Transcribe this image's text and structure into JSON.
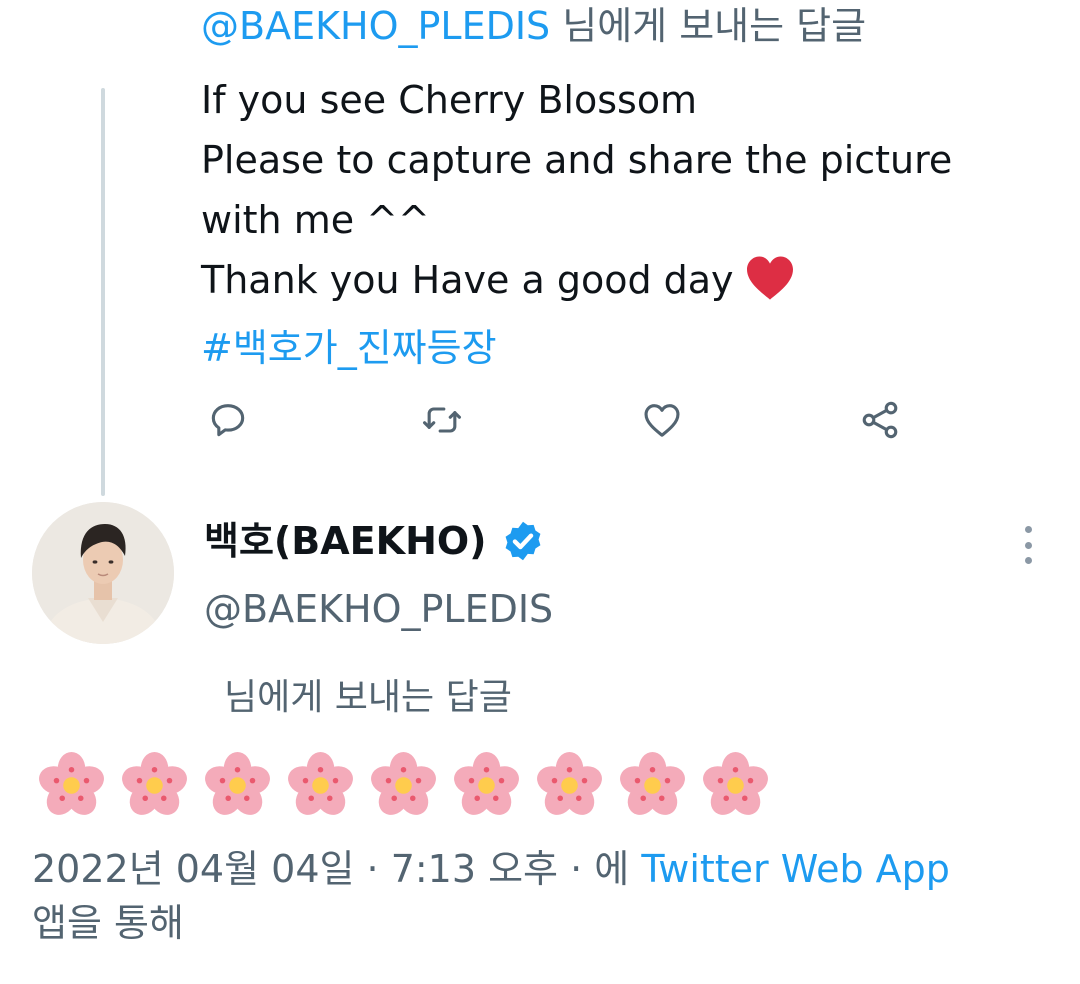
{
  "reply_context": {
    "handle": "@BAEKHO_PLEDIS",
    "suffix": "님에게 보내는 답글"
  },
  "parent_tweet": {
    "lines": [
      "If you see Cherry Blossom",
      "Please to capture and share the picture",
      "with me ^^",
      "Thank you Have a good day"
    ],
    "emoji": "❤",
    "hashtag": "#백호가_진짜등장"
  },
  "actions": [
    {
      "name": "reply",
      "icon": "reply-icon"
    },
    {
      "name": "retweet",
      "icon": "retweet-icon"
    },
    {
      "name": "like",
      "icon": "heart-icon"
    },
    {
      "name": "share",
      "icon": "share-icon"
    }
  ],
  "reply_tweet": {
    "display_name": "백호(BAEKHO)",
    "username": "@BAEKHO_PLEDIS",
    "verified": true,
    "reply_note": "님에게 보내는 답글",
    "emoji_text": "🌸🌸🌸🌸🌸🌸🌸🌸🌸",
    "timestamp": "2022년 04월 04일 · 7:13 오후 · 에 ",
    "source": "Twitter Web App",
    "source_suffix": "앱을 통해"
  },
  "colors": {
    "accent": "#1d9bf0",
    "secondary_text": "#536471",
    "thread_line": "#cfd9de",
    "verified_badge": "#1d9bf0",
    "heart_emoji": "#dd2e44",
    "blossom_petal": "#f4abba",
    "blossom_center": "#ffcc4d"
  }
}
